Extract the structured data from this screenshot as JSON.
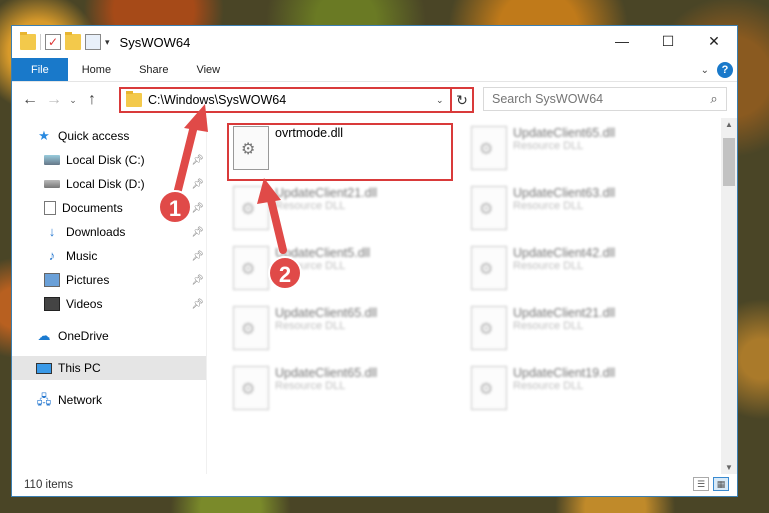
{
  "window": {
    "title": "SysWOW64",
    "controls": {
      "minimize": "—",
      "maximize": "☐",
      "close": "✕"
    }
  },
  "ribbon": {
    "tabs": [
      "File",
      "Home",
      "Share",
      "View"
    ],
    "help": "?"
  },
  "nav": {
    "back": "←",
    "forward": "→",
    "recent": "⌄",
    "up": "↑",
    "address": "C:\\Windows\\SysWOW64",
    "search_placeholder": "Search SysWOW64"
  },
  "sidebar": {
    "items": [
      {
        "label": "Quick access",
        "icon": "star-icon",
        "pinned": false
      },
      {
        "label": "Local Disk (C:)",
        "icon": "drive-icon",
        "pinned": true
      },
      {
        "label": "Local Disk (D:)",
        "icon": "drive-icon",
        "pinned": true
      },
      {
        "label": "Documents",
        "icon": "document-icon",
        "pinned": true
      },
      {
        "label": "Downloads",
        "icon": "download-icon",
        "pinned": true
      },
      {
        "label": "Music",
        "icon": "music-icon",
        "pinned": true
      },
      {
        "label": "Pictures",
        "icon": "pictures-icon",
        "pinned": true
      },
      {
        "label": "Videos",
        "icon": "videos-icon",
        "pinned": true
      },
      {
        "label": "OneDrive",
        "icon": "cloud-icon",
        "pinned": false
      },
      {
        "label": "This PC",
        "icon": "computer-icon",
        "pinned": false,
        "selected": true
      },
      {
        "label": "Network",
        "icon": "network-icon",
        "pinned": false
      }
    ]
  },
  "files": [
    {
      "name": "ovrtmode.dll",
      "type": "",
      "blurred": false
    },
    {
      "name": "UpdateClient65.dll",
      "type": "Resource DLL",
      "blurred": true
    },
    {
      "name": "UpdateClient21.dll",
      "type": "Resource DLL",
      "blurred": true
    },
    {
      "name": "UpdateClient63.dll",
      "type": "Resource DLL",
      "blurred": true
    },
    {
      "name": "UpdateClient5.dll",
      "type": "Resource DLL",
      "blurred": true
    },
    {
      "name": "UpdateClient42.dll",
      "type": "Resource DLL",
      "blurred": true
    },
    {
      "name": "UpdateClient65.dll",
      "type": "Resource DLL",
      "blurred": true
    },
    {
      "name": "UpdateClient21.dll",
      "type": "Resource DLL",
      "blurred": true
    },
    {
      "name": "UpdateClient65.dll",
      "type": "Resource DLL",
      "blurred": true
    },
    {
      "name": "UpdateClient19.dll",
      "type": "Resource DLL",
      "blurred": true
    }
  ],
  "status": {
    "count": "110 items"
  },
  "annotations": {
    "step1": "1",
    "step2": "2",
    "color": "#e04a48"
  }
}
